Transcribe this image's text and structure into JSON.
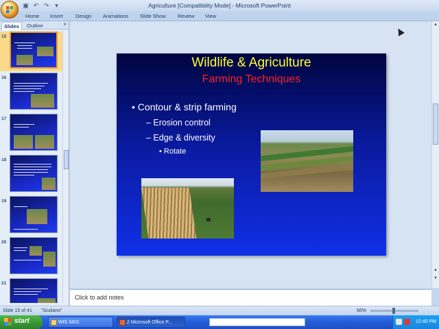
{
  "window": {
    "title": "Agriculture [Compatibility Mode] - Microsoft PowerPoint",
    "controls": [
      "minimize",
      "maximize",
      "close"
    ]
  },
  "ribbon": {
    "tabs": [
      "Home",
      "Insert",
      "Design",
      "Animations",
      "Slide Show",
      "Review",
      "View"
    ]
  },
  "panel": {
    "tabs": [
      "Slides",
      "Outline"
    ],
    "close_label": "×",
    "thumbnails": [
      {
        "number": "15",
        "selected": true
      },
      {
        "number": "16",
        "selected": false
      },
      {
        "number": "17",
        "selected": false
      },
      {
        "number": "18",
        "selected": false
      },
      {
        "number": "19",
        "selected": false
      },
      {
        "number": "20",
        "selected": false
      },
      {
        "number": "21",
        "selected": false
      }
    ]
  },
  "slide": {
    "title": "Wildlife & Agriculture",
    "subtitle": "Farming Techniques",
    "bullets": {
      "level1": "• Contour & strip farming",
      "level2_a": "– Erosion control",
      "level2_b": "– Edge & diversity",
      "level3": "• Rotate"
    }
  },
  "notes": {
    "placeholder": "Click to add notes"
  },
  "status": {
    "slide_count": "Slide 15 of 41",
    "theme": "\"Giuliano\"",
    "zoom": "66%"
  },
  "taskbar": {
    "start_label": "start",
    "tasks": [
      "WIS 3401",
      "2 Microsoft Office P..."
    ],
    "clock": "12:40 PM"
  },
  "colors": {
    "slide_title": "#ffff33",
    "slide_subtitle": "#ff2020",
    "slide_bg_top": "#000540",
    "slide_bg_bottom": "#1030e8"
  }
}
